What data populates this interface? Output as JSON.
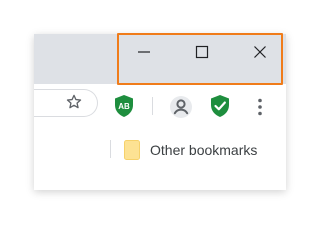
{
  "colors": {
    "titlebar": "#dee1e6",
    "highlight": "#f07c1a",
    "extension_green": "#1e8e3e",
    "folder_yellow": "#fde293",
    "icon": "#5f6368"
  },
  "window_controls": {
    "minimize": {
      "icon": "minimize-icon"
    },
    "maximize": {
      "icon": "maximize-icon"
    },
    "close": {
      "icon": "close-icon"
    }
  },
  "toolbar": {
    "bookmark_star": {
      "icon": "star-outline-icon"
    },
    "extensions": [
      {
        "badge_text": "AB",
        "icon": "shield-ab-icon"
      },
      {
        "icon": "shield-check-icon"
      }
    ],
    "profile": {
      "icon": "account-circle-icon"
    },
    "menu": {
      "icon": "vertical-dots-menu-icon"
    }
  },
  "bookmarks_bar": {
    "items": [
      {
        "label": "Other bookmarks",
        "icon": "folder-icon"
      }
    ]
  }
}
